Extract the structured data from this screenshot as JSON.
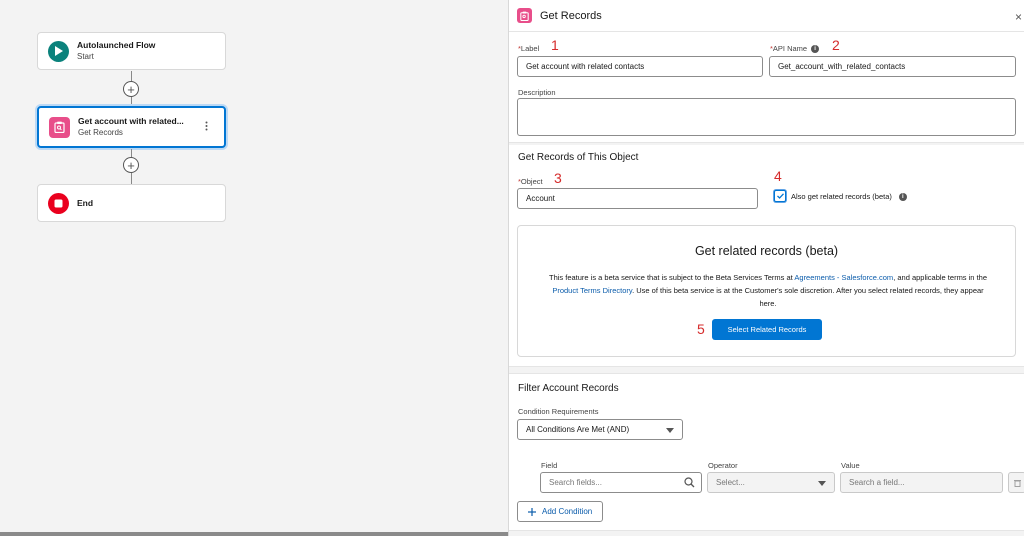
{
  "canvas": {
    "nodes": [
      {
        "title": "Autolaunched Flow",
        "subtitle": "Start"
      },
      {
        "title": "Get account with related...",
        "subtitle": "Get Records"
      },
      {
        "title": "End",
        "subtitle": ""
      }
    ],
    "add_element_symbol": "+"
  },
  "panel": {
    "title": "Get Records",
    "close_symbol": "×",
    "label_field": {
      "required_mark": "*",
      "label": "Label",
      "value": "Get account with related contacts"
    },
    "api_name_field": {
      "required_mark": "*",
      "label": "API Name",
      "value": "Get_account_with_related_contacts"
    },
    "description_field": {
      "label": "Description",
      "value": ""
    },
    "object_section": {
      "title": "Get Records of This Object",
      "object_field": {
        "required_mark": "*",
        "label": "Object",
        "value": "Account"
      },
      "related_checkbox_label": "Also get related records (beta)",
      "related_checkbox_checked": true
    },
    "beta_box": {
      "title": "Get related records (beta)",
      "desc_1": "This feature is a beta service that is subject to the Beta Services Terms at ",
      "link_1": "Agreements - Salesforce.com",
      "desc_2": ", and applicable terms in the ",
      "link_2": "Product Terms Directory",
      "desc_3": ". Use of this beta service is at the Customer's sole discretion. After you select related records, they appear here.",
      "button_label": "Select Related Records"
    },
    "filter_section": {
      "title": "Filter Account Records",
      "condition_label": "Condition Requirements",
      "condition_value": "All Conditions Are Met (AND)",
      "field_col": "Field",
      "field_placeholder": "Search fields...",
      "operator_col": "Operator",
      "operator_placeholder": "Select...",
      "value_col": "Value",
      "value_placeholder": "Search a field...",
      "add_condition_label": "Add Condition"
    },
    "annotations": [
      "1",
      "2",
      "3",
      "4",
      "5"
    ]
  },
  "colors": {
    "brand": "#0176d3",
    "start_icon": "#0b827c",
    "get_records_icon": "#e84e8a",
    "end_icon": "#ea001e",
    "annotation": "#d52b2b"
  }
}
